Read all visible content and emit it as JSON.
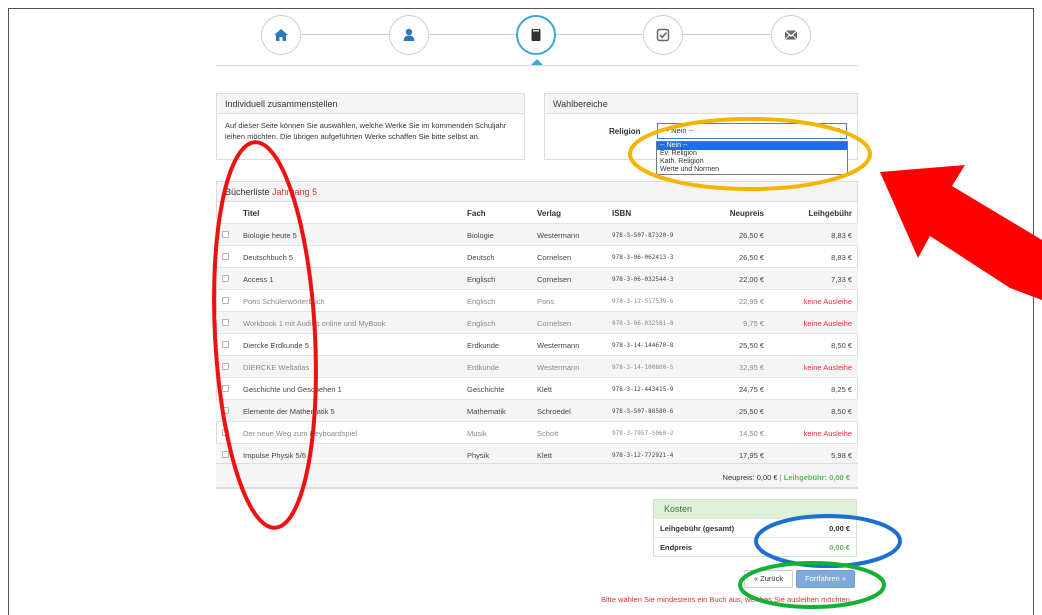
{
  "steps": [
    {
      "icon": "home-icon",
      "active": false
    },
    {
      "icon": "user-icon",
      "active": false
    },
    {
      "icon": "book-icon",
      "active": true
    },
    {
      "icon": "check-square-icon",
      "active": false
    },
    {
      "icon": "envelope-icon",
      "active": false
    }
  ],
  "individual": {
    "title": "Individuell zusammenstellen",
    "text": "Auf dieser Seite können Sie auswählen, welche Werke Sie im kommenden Schuljahr leihen möchten. Die übrigen aufgeführten Werke schaffen Sie bitte selbst an."
  },
  "wahl": {
    "title": "Wahlbereiche",
    "religion_label": "Religion",
    "selected": "-- Nein --",
    "options": [
      "-- Nein --",
      "Ev. Religion",
      "Kath. Religion",
      "Werte und Normen"
    ]
  },
  "booklist": {
    "title": "Bücherliste",
    "year": "Jahrgang 5",
    "columns": {
      "titel": "Titel",
      "fach": "Fach",
      "verlag": "Verlag",
      "isbn": "ISBN",
      "neupreis": "Neupreis",
      "leihgebuehr": "Leihgebühr"
    },
    "rows": [
      {
        "titel": "Biologie heute 5",
        "fach": "Biologie",
        "verlag": "Westermann",
        "isbn": "978-3-507-87320-9",
        "neupreis": "26,50 €",
        "leih": "8,83 €",
        "no_loan": false
      },
      {
        "titel": "Deutschbuch 5",
        "fach": "Deutsch",
        "verlag": "Cornelsen",
        "isbn": "978-3-06-062413-3",
        "neupreis": "26,50 €",
        "leih": "8,83 €",
        "no_loan": false
      },
      {
        "titel": "Access 1",
        "fach": "Englisch",
        "verlag": "Cornelsen",
        "isbn": "978-3-06-032544-3",
        "neupreis": "22,00 €",
        "leih": "7,33 €",
        "no_loan": false
      },
      {
        "titel": "Pons Schülerwörterbuch",
        "fach": "Englisch",
        "verlag": "Pons",
        "isbn": "978-3-12-517539-6",
        "neupreis": "22,99 €",
        "leih": "keine Ausleihe",
        "no_loan": true
      },
      {
        "titel": "Workbook 1 mit Audios online und MyBook",
        "fach": "Englisch",
        "verlag": "Cornelsen",
        "isbn": "978-3-06-032581-8",
        "neupreis": "9,75 €",
        "leih": "keine Ausleihe",
        "no_loan": true
      },
      {
        "titel": "Diercke Erdkunde 5",
        "fach": "Erdkunde",
        "verlag": "Westermann",
        "isbn": "978-3-14-144670-8",
        "neupreis": "25,50 €",
        "leih": "8,50 €",
        "no_loan": false
      },
      {
        "titel": "DIERCKE Weltatlas",
        "fach": "Erdkunde",
        "verlag": "Westermann",
        "isbn": "978-3-14-100800-5",
        "neupreis": "32,95 €",
        "leih": "keine Ausleihe",
        "no_loan": true
      },
      {
        "titel": "Geschichte und Geschehen 1",
        "fach": "Geschichte",
        "verlag": "Klett",
        "isbn": "978-3-12-443415-9",
        "neupreis": "24,75 €",
        "leih": "8,25 €",
        "no_loan": false
      },
      {
        "titel": "Elemente der Mathematik 5",
        "fach": "Mathematik",
        "verlag": "Schroedel",
        "isbn": "978-3-507-88580-6",
        "neupreis": "25,50 €",
        "leih": "8,50 €",
        "no_loan": false
      },
      {
        "titel": "Der neue Weg zum Keyboardspiel",
        "fach": "Musik",
        "verlag": "Schott",
        "isbn": "978-3-7957-5060-2",
        "neupreis": "14,50 €",
        "leih": "keine Ausleihe",
        "no_loan": true
      },
      {
        "titel": "Impulse Physik 5/6",
        "fach": "Physik",
        "verlag": "Klett",
        "isbn": "978-3-12-772921-4",
        "neupreis": "17,95 €",
        "leih": "5,98 €",
        "no_loan": false
      }
    ],
    "summary": {
      "neupreis_label": "Neupreis: 0,00 €",
      "sep": " | ",
      "leih_label": "Leihgebühr: 0,00 €"
    }
  },
  "kosten": {
    "title": "Kosten",
    "leih_label": "Leihgebühr (gesamt)",
    "leih_value": "0,00 €",
    "end_label": "Endpreis",
    "end_value": "0,00 €"
  },
  "buttons": {
    "back": "« Zurück",
    "next": "Fortfahren »"
  },
  "warning": "Bitte wählen Sie mindestens ein Buch aus, welches Sie ausleihen möchten.",
  "colors": {
    "accent": "#3aa7d8",
    "red": "#e0323a",
    "green": "#5cb85c",
    "primary_btn": "#7ea9d8"
  }
}
